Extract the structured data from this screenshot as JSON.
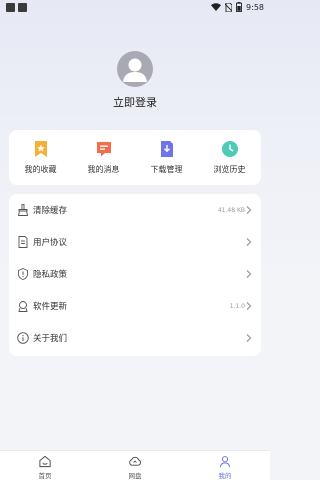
{
  "status_bar": {
    "time": "9:58"
  },
  "profile": {
    "login_label": "立即登录"
  },
  "quick_actions": [
    {
      "label": "我的收藏",
      "icon": "favorites-icon",
      "color": "#f3b13a"
    },
    {
      "label": "我的消息",
      "icon": "messages-icon",
      "color": "#f26d4f"
    },
    {
      "label": "下载管理",
      "icon": "download-icon",
      "color": "#6f74e6"
    },
    {
      "label": "浏览历史",
      "icon": "history-icon",
      "color": "#4fc9b8"
    }
  ],
  "menu": [
    {
      "label": "清除缓存",
      "value": "41.48 KB",
      "icon": "clear-cache-icon"
    },
    {
      "label": "用户协议",
      "value": "",
      "icon": "user-agreement-icon"
    },
    {
      "label": "隐私政策",
      "value": "",
      "icon": "privacy-policy-icon"
    },
    {
      "label": "软件更新",
      "value": "1.1.0",
      "icon": "software-update-icon"
    },
    {
      "label": "关于我们",
      "value": "",
      "icon": "about-us-icon"
    }
  ],
  "tabs": [
    {
      "label": "首页",
      "icon": "home-icon",
      "active": false
    },
    {
      "label": "网盘",
      "icon": "cloud-drive-icon",
      "active": false
    },
    {
      "label": "我的",
      "icon": "profile-icon",
      "active": true
    }
  ],
  "colors": {
    "accent": "#6e72d6",
    "avatar_bg": "#a8a9b2"
  }
}
